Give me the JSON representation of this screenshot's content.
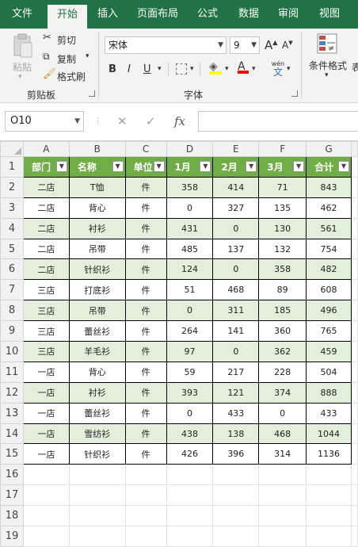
{
  "tabs": [
    "文件",
    "开始",
    "插入",
    "页面布局",
    "公式",
    "数据",
    "审阅",
    "视图"
  ],
  "active_tab": "开始",
  "ribbon": {
    "paste_label": "粘贴",
    "cut_label": "剪切",
    "copy_label": "复制",
    "format_painter_label": "格式刷",
    "clipboard_group": "剪贴板",
    "font_name": "宋体",
    "font_size": "9",
    "font_group": "字体",
    "conditional_format_label": "条件格式",
    "next_group_fragment": "表",
    "bold": "B",
    "italic": "I",
    "underline": "U",
    "grow_font": "A",
    "shrink_font": "A",
    "font_color": "A",
    "phonetic": "wén",
    "phonetic_char": "文"
  },
  "formula_bar": {
    "name_box": "O10",
    "formula": "",
    "fx_label": "fx"
  },
  "columns": [
    "A",
    "B",
    "C",
    "D",
    "E",
    "F",
    "G"
  ],
  "rows": [
    "1",
    "2",
    "3",
    "4",
    "5",
    "6",
    "7",
    "8",
    "9",
    "10",
    "11",
    "12",
    "13",
    "14",
    "15",
    "16",
    "17",
    "18",
    "19"
  ],
  "table": {
    "headers": [
      "部门",
      "名称",
      "单位",
      "1月",
      "2月",
      "3月",
      "合计"
    ],
    "data": [
      [
        "二店",
        "T恤",
        "件",
        "358",
        "414",
        "71",
        "843"
      ],
      [
        "二店",
        "背心",
        "件",
        "0",
        "327",
        "135",
        "462"
      ],
      [
        "二店",
        "衬衫",
        "件",
        "431",
        "0",
        "130",
        "561"
      ],
      [
        "二店",
        "吊带",
        "件",
        "485",
        "137",
        "132",
        "754"
      ],
      [
        "二店",
        "针织衫",
        "件",
        "124",
        "0",
        "358",
        "482"
      ],
      [
        "三店",
        "打底衫",
        "件",
        "51",
        "468",
        "89",
        "608"
      ],
      [
        "三店",
        "吊带",
        "件",
        "0",
        "311",
        "185",
        "496"
      ],
      [
        "三店",
        "蕾丝衫",
        "件",
        "264",
        "141",
        "360",
        "765"
      ],
      [
        "三店",
        "羊毛衫",
        "件",
        "97",
        "0",
        "362",
        "459"
      ],
      [
        "一店",
        "背心",
        "件",
        "59",
        "217",
        "228",
        "504"
      ],
      [
        "一店",
        "衬衫",
        "件",
        "393",
        "121",
        "374",
        "888"
      ],
      [
        "一店",
        "蕾丝衫",
        "件",
        "0",
        "433",
        "0",
        "433"
      ],
      [
        "一店",
        "雪纺衫",
        "件",
        "438",
        "138",
        "468",
        "1044"
      ],
      [
        "一店",
        "针织衫",
        "件",
        "426",
        "396",
        "314",
        "1136"
      ]
    ]
  },
  "colors": {
    "ribbon_green": "#217346",
    "header_green": "#70ad47",
    "band_green": "#e2efda"
  }
}
